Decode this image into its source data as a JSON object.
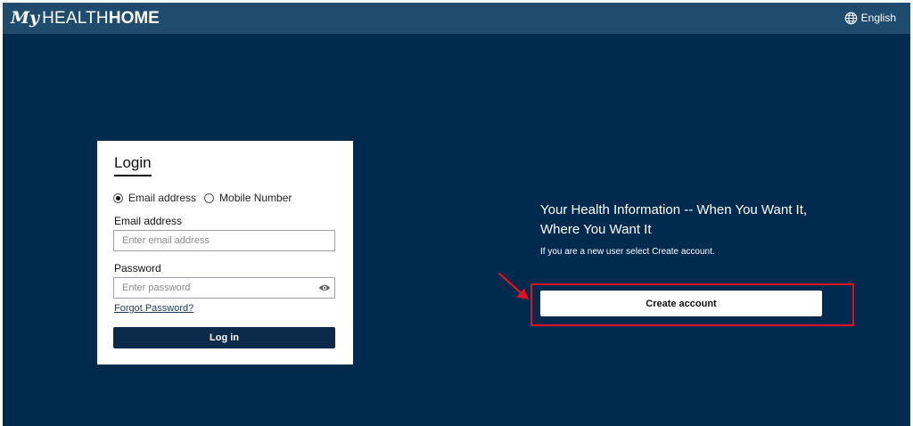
{
  "header": {
    "logo": {
      "my": "My",
      "health": "HEALTH",
      "home": "HOME"
    },
    "language": {
      "icon": "globe-icon",
      "label": "English"
    }
  },
  "login": {
    "title": "Login",
    "radio_options": [
      {
        "label": "Email address",
        "checked": true
      },
      {
        "label": "Mobile Number",
        "checked": false
      }
    ],
    "email": {
      "label": "Email address",
      "placeholder": "Enter email address",
      "value": ""
    },
    "password": {
      "label": "Password",
      "placeholder": "Enter password",
      "value": "",
      "toggle_icon": "eye-icon"
    },
    "forgot_label": "Forgot Password?",
    "login_label": "Log in"
  },
  "promo": {
    "title": "Your Health Information -- When You Want It, Where You Want It",
    "subtitle": "If you are a new user select Create account.",
    "create_label": "Create account"
  },
  "annotation": {
    "color": "#e0101c",
    "icon": "arrow-icon"
  },
  "colors": {
    "page_background": "#002a4e",
    "header_background": "#1f4b6e",
    "button_primary": "#0c2b4b",
    "card_background": "#ffffff"
  }
}
